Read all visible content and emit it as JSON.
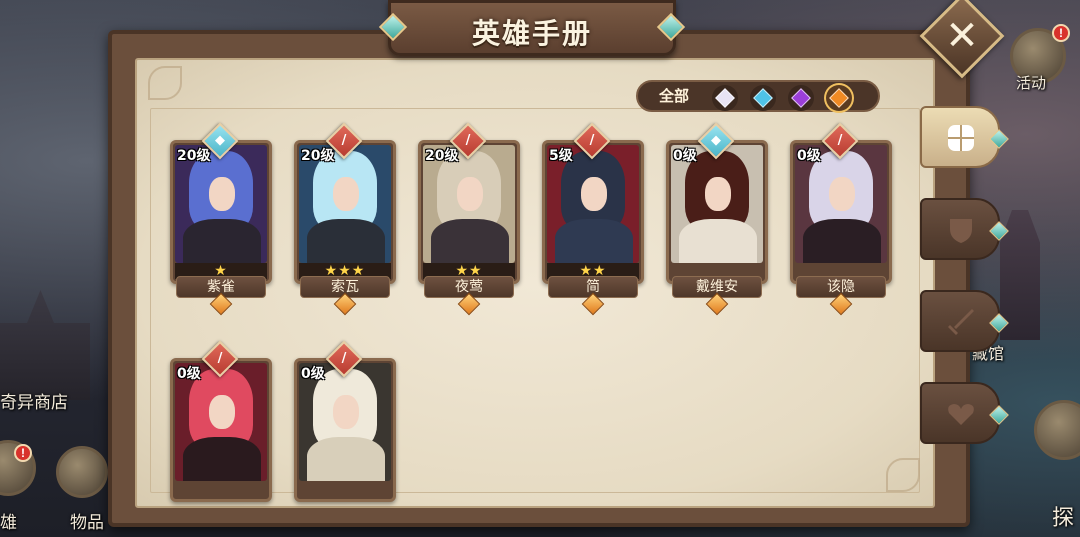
{
  "title": "英雄手册",
  "close_label": "✕",
  "side": {
    "activity_label": "活动",
    "shop_label": "奇异商店",
    "hero_label": "雄",
    "items_label": "物品",
    "museum_label": "藏馆",
    "explore_label": "探",
    "badge_mark": "!"
  },
  "filter": {
    "all_label": "全部",
    "gems": [
      {
        "icon": "white-gem-icon",
        "color": "#e8e3f4",
        "selected": false
      },
      {
        "icon": "blue-gem-icon",
        "color": "#4fc3e8",
        "selected": false
      },
      {
        "icon": "purple-gem-icon",
        "color": "#9c3fd9",
        "selected": false
      },
      {
        "icon": "orange-gem-icon",
        "color": "#f08a24",
        "selected": true
      }
    ]
  },
  "tabs": [
    {
      "icon": "grid-icon",
      "active": true
    },
    {
      "icon": "shield-icon",
      "active": false
    },
    {
      "icon": "sword-icon",
      "active": false
    },
    {
      "icon": "heart-icon",
      "active": false
    }
  ],
  "heroes": [
    {
      "name": "紫雀",
      "level": "20级",
      "stars": "★",
      "class": "shield",
      "hair": "#5a6fd0",
      "bg": "#3b2a5a",
      "body": "#2a2530"
    },
    {
      "name": "索瓦",
      "level": "20级",
      "stars": "★★★",
      "class": "sword",
      "hair": "#b8e6f4",
      "bg": "#2a4a6a",
      "body": "#2a2f38"
    },
    {
      "name": "夜莺",
      "level": "20级",
      "stars": "★★",
      "class": "sword",
      "hair": "#d8cdb8",
      "bg": "#b9ab8f",
      "body": "#3a3238"
    },
    {
      "name": "简",
      "level": "5级",
      "stars": "★★",
      "class": "sword",
      "hair": "#2a3348",
      "bg": "#7a1f2a",
      "body": "#2f3a52"
    },
    {
      "name": "戴维安",
      "level": "0级",
      "stars": "",
      "class": "shield",
      "hair": "#4a1e18",
      "bg": "#c8bfb0",
      "body": "#e8e0d2"
    },
    {
      "name": "该隐",
      "level": "0级",
      "stars": "",
      "class": "sword",
      "hair": "#d9d4e8",
      "bg": "#5a3640",
      "body": "#2a1e24"
    },
    {
      "name": "",
      "level": "0级",
      "stars": "",
      "class": "sword",
      "hair": "#e04a60",
      "bg": "#6a1e2a",
      "body": "#2a1a1e"
    },
    {
      "name": "",
      "level": "0级",
      "stars": "",
      "class": "sword",
      "hair": "#efe9da",
      "bg": "#3a3630",
      "body": "#d8cfba"
    }
  ]
}
